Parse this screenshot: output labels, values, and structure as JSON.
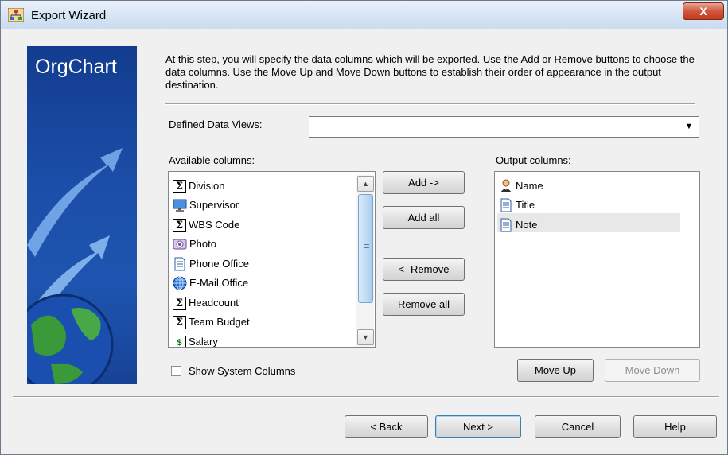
{
  "window": {
    "title": "Export Wizard",
    "close_label": "X"
  },
  "banner": {
    "title": "OrgChart"
  },
  "intro_text": "At this step, you will specify the data columns which will be exported. Use the Add or Remove buttons to choose the data columns. Use the Move Up and Move Down buttons to establish their order of appearance in the output destination.",
  "defined_views": {
    "label": "Defined Data Views:",
    "value": ""
  },
  "available": {
    "label": "Available columns:",
    "items": [
      {
        "label": "Division",
        "icon": "sigma-icon"
      },
      {
        "label": "Supervisor",
        "icon": "monitor-icon"
      },
      {
        "label": "WBS Code",
        "icon": "sigma-icon"
      },
      {
        "label": "Photo",
        "icon": "camera-icon"
      },
      {
        "label": "Phone Office",
        "icon": "document-icon"
      },
      {
        "label": "E-Mail Office",
        "icon": "globe-icon"
      },
      {
        "label": "Headcount",
        "icon": "sigma-icon"
      },
      {
        "label": "Team Budget",
        "icon": "sigma-icon"
      },
      {
        "label": "Salary",
        "icon": "dollar-icon"
      }
    ]
  },
  "output": {
    "label": "Output columns:",
    "items": [
      {
        "label": "Name",
        "icon": "person-icon"
      },
      {
        "label": "Title",
        "icon": "document-icon"
      },
      {
        "label": "Note",
        "icon": "document-icon",
        "selected": true
      }
    ]
  },
  "buttons": {
    "add": "Add ->",
    "add_all": "Add all",
    "remove": "<- Remove",
    "remove_all": "Remove all",
    "move_up": "Move Up",
    "move_down": "Move Down",
    "back": "< Back",
    "next": "Next >",
    "cancel": "Cancel",
    "help": "Help"
  },
  "show_system_columns": {
    "label": "Show System Columns",
    "checked": false
  }
}
